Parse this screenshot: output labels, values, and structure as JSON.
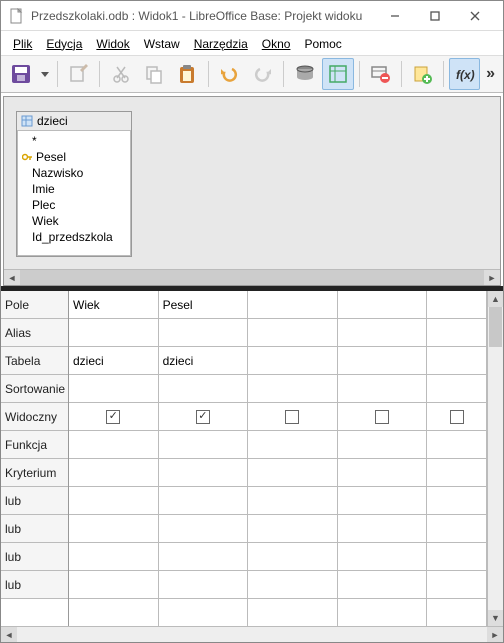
{
  "title": "Przedszkolaki.odb : Widok1 - LibreOffice Base: Projekt widoku",
  "menus": [
    "Plik",
    "Edycja",
    "Widok",
    "Wstaw",
    "Narzędzia",
    "Okno",
    "Pomoc"
  ],
  "toolbar": {
    "save": "save",
    "dropdown": "dd",
    "edit": "edit",
    "cut": "cut",
    "copy": "copy",
    "paste": "paste",
    "undo": "undo",
    "redo": "redo",
    "run": "run",
    "design": "design",
    "delete": "delete",
    "add": "add",
    "fx": "fx"
  },
  "table": {
    "name": "dzieci",
    "fields": [
      "*",
      "Pesel",
      "Nazwisko",
      "Imie",
      "Plec",
      "Wiek",
      "Id_przedszkola"
    ],
    "primary_key": "Pesel"
  },
  "grid": {
    "row_headers": [
      "Pole",
      "Alias",
      "Tabela",
      "Sortowanie",
      "Widoczny",
      "Funkcja",
      "Kryterium",
      "lub",
      "lub",
      "lub",
      "lub"
    ],
    "columns": [
      {
        "pole": "Wiek",
        "alias": "",
        "tabela": "dzieci",
        "sort": "",
        "visible": true,
        "funkcja": "",
        "kryterium": "",
        "lub1": "",
        "lub2": "",
        "lub3": "",
        "lub4": ""
      },
      {
        "pole": "Pesel",
        "alias": "",
        "tabela": "dzieci",
        "sort": "",
        "visible": true,
        "funkcja": "",
        "kryterium": "",
        "lub1": "",
        "lub2": "",
        "lub3": "",
        "lub4": ""
      },
      {
        "pole": "",
        "alias": "",
        "tabela": "",
        "sort": "",
        "visible": false,
        "funkcja": "",
        "kryterium": "",
        "lub1": "",
        "lub2": "",
        "lub3": "",
        "lub4": ""
      },
      {
        "pole": "",
        "alias": "",
        "tabela": "",
        "sort": "",
        "visible": false,
        "funkcja": "",
        "kryterium": "",
        "lub1": "",
        "lub2": "",
        "lub3": "",
        "lub4": ""
      },
      {
        "pole": "",
        "alias": "",
        "tabela": "",
        "sort": "",
        "visible": false,
        "funkcja": "",
        "kryterium": "",
        "lub1": "",
        "lub2": "",
        "lub3": "",
        "lub4": ""
      }
    ]
  }
}
